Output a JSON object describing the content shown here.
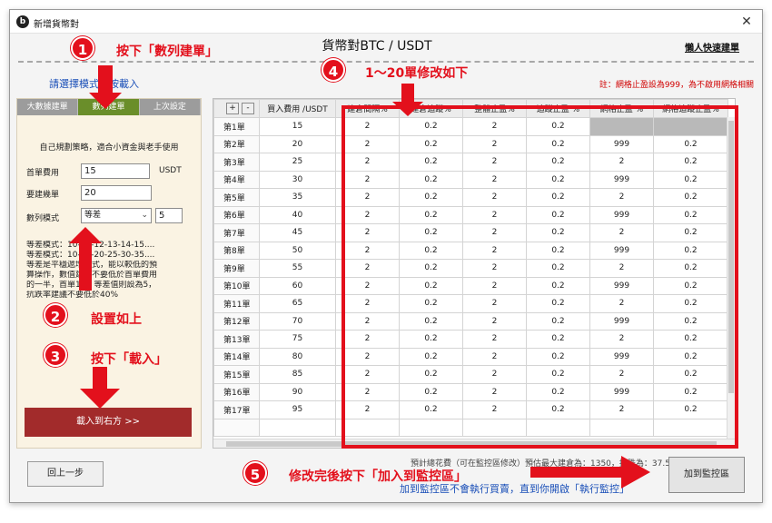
{
  "window": {
    "title": "新增貨幣對",
    "app_icon": "b",
    "close_glyph": "✕"
  },
  "header": {
    "title": "貨幣對BTC / USDT",
    "quick_link": "懶人快速建單",
    "hint_left": "請選擇模式後按載入",
    "note_right": "註：網格止盈設為999，為不啟用網格相關"
  },
  "left": {
    "tabs": [
      {
        "label": "大數據建單",
        "active": false
      },
      {
        "label": "數列建單",
        "active": true
      },
      {
        "label": "上次設定",
        "active": false
      }
    ],
    "description": "自己規劃策略，適合小資金與老手使用",
    "first_fee_label": "首單費用",
    "first_fee_value": "15",
    "first_fee_unit": "USDT",
    "orders_label": "要建幾單",
    "orders_value": "20",
    "mode_label": "數列模式",
    "mode_value": "等差",
    "mode_step": "5",
    "explain": [
      "等差模式：10-11-12-13-14-15....",
      "等差模式：10-15-20-25-30-35....",
      "等差是平穩遞增模式，能以較低的預",
      "算操作，數值建議不要低於首單費用",
      "的一半，首單10，等差值則設為5，",
      "抗跌率建議不要低於40%"
    ],
    "load_button": "載入到右方 >>"
  },
  "table": {
    "plus": "+",
    "minus": "-",
    "headers": [
      "",
      "買入費用 /USDT",
      "建倉間隔%",
      "建倉追蹤%",
      "整體止盈%",
      "追蹤止盈 %",
      "網格止盈 %",
      "網格追蹤止盈%"
    ],
    "rows": [
      [
        "第1單",
        "15",
        "2",
        "0.2",
        "2",
        "0.2",
        "",
        ""
      ],
      [
        "第2單",
        "20",
        "2",
        "0.2",
        "2",
        "0.2",
        "999",
        "0.2"
      ],
      [
        "第3單",
        "25",
        "2",
        "0.2",
        "2",
        "0.2",
        "2",
        "0.2"
      ],
      [
        "第4單",
        "30",
        "2",
        "0.2",
        "2",
        "0.2",
        "999",
        "0.2"
      ],
      [
        "第5單",
        "35",
        "2",
        "0.2",
        "2",
        "0.2",
        "2",
        "0.2"
      ],
      [
        "第6單",
        "40",
        "2",
        "0.2",
        "2",
        "0.2",
        "999",
        "0.2"
      ],
      [
        "第7單",
        "45",
        "2",
        "0.2",
        "2",
        "0.2",
        "2",
        "0.2"
      ],
      [
        "第8單",
        "50",
        "2",
        "0.2",
        "2",
        "0.2",
        "999",
        "0.2"
      ],
      [
        "第9單",
        "55",
        "2",
        "0.2",
        "2",
        "0.2",
        "2",
        "0.2"
      ],
      [
        "第10單",
        "60",
        "2",
        "0.2",
        "2",
        "0.2",
        "999",
        "0.2"
      ],
      [
        "第11單",
        "65",
        "2",
        "0.2",
        "2",
        "0.2",
        "2",
        "0.2"
      ],
      [
        "第12單",
        "70",
        "2",
        "0.2",
        "2",
        "0.2",
        "999",
        "0.2"
      ],
      [
        "第13單",
        "75",
        "2",
        "0.2",
        "2",
        "0.2",
        "2",
        "0.2"
      ],
      [
        "第14單",
        "80",
        "2",
        "0.2",
        "2",
        "0.2",
        "999",
        "0.2"
      ],
      [
        "第15單",
        "85",
        "2",
        "0.2",
        "2",
        "0.2",
        "2",
        "0.2"
      ],
      [
        "第16單",
        "90",
        "2",
        "0.2",
        "2",
        "0.2",
        "999",
        "0.2"
      ],
      [
        "第17單",
        "95",
        "2",
        "0.2",
        "2",
        "0.2",
        "2",
        "0.2"
      ],
      [
        "",
        "",
        "",
        "",
        "",
        "",
        "",
        ""
      ]
    ]
  },
  "footer": {
    "prev_button": "回上一步",
    "add_button": "加到監控區",
    "info_top": "預計總花費（可在監控區修改）預估最大建倉為：1350，抗跌為：37.5%",
    "info_bottom": "加到監控區不會執行買賣，直到你開啟「執行監控」"
  },
  "annotations": {
    "step1": {
      "num": "1",
      "text": "按下「數列建單」"
    },
    "step2": {
      "num": "2",
      "text": "設置如上"
    },
    "step3": {
      "num": "3",
      "text": "按下「載入」"
    },
    "step4": {
      "num": "4",
      "text": "1～20單修改如下"
    },
    "step5": {
      "num": "5",
      "text": "修改完後按下「加入到監控區」"
    },
    "accent_color": "#e3101c"
  }
}
